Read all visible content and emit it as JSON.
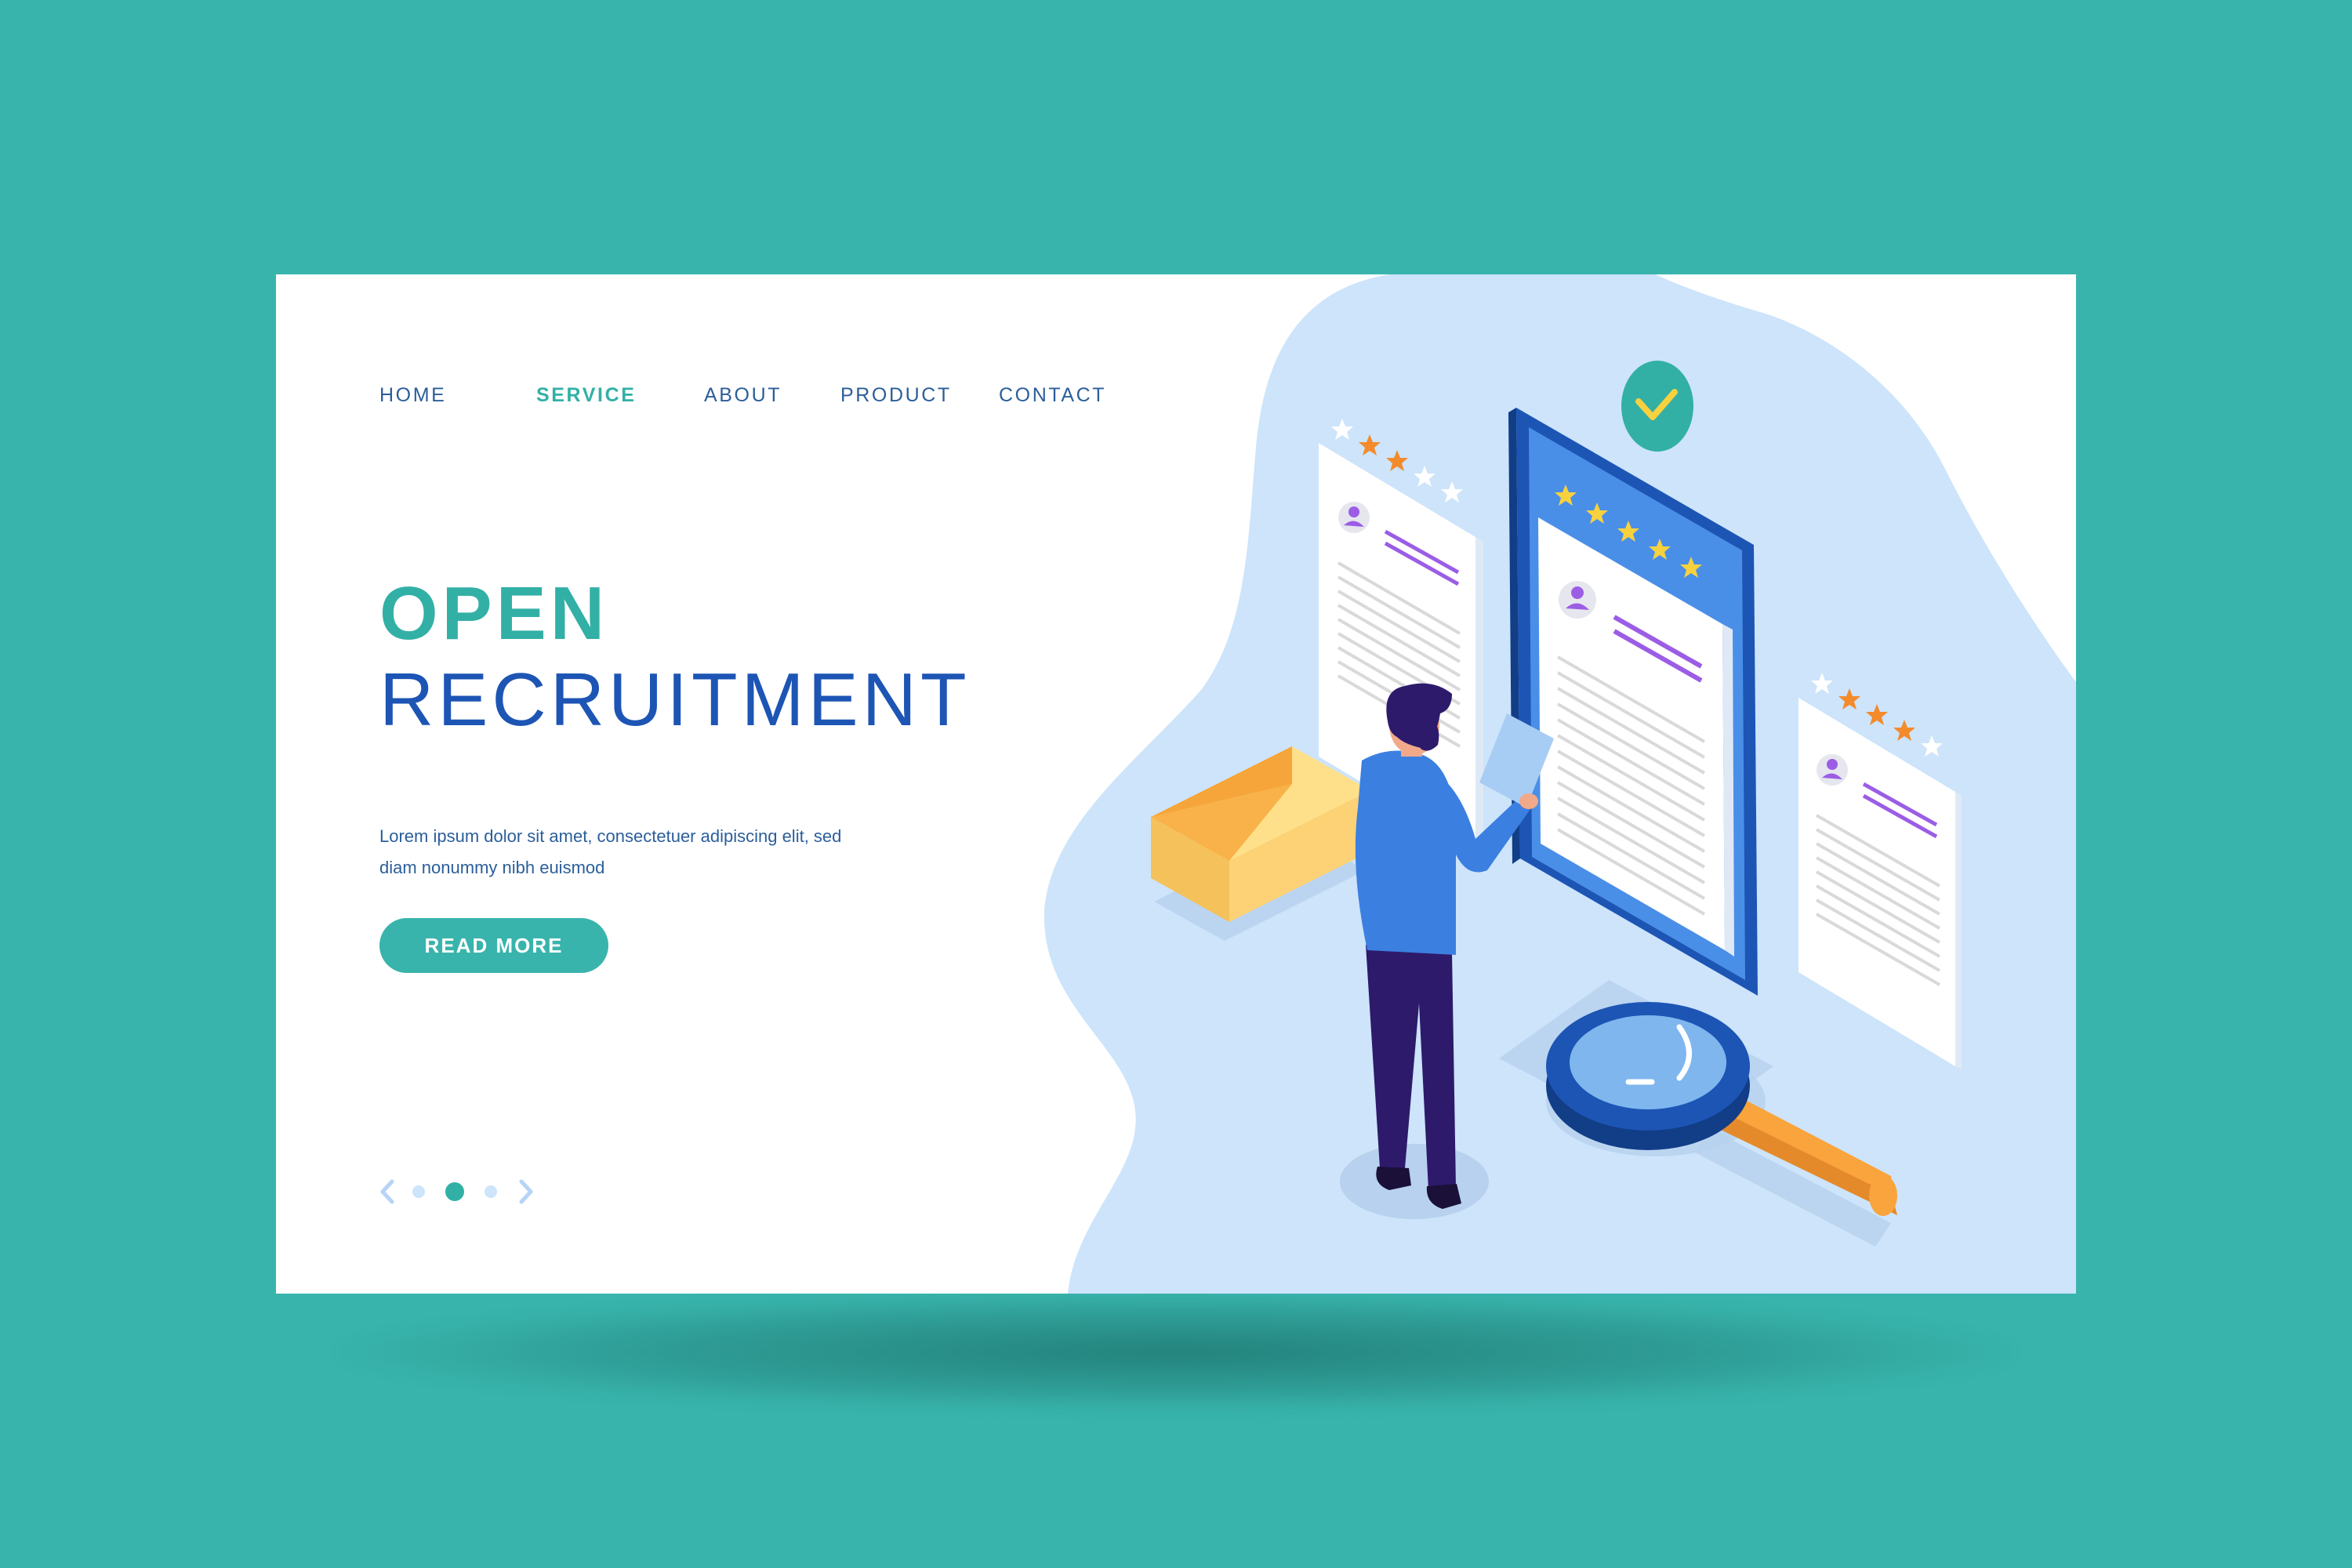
{
  "nav": {
    "items": [
      {
        "label": "HOME"
      },
      {
        "label": "SERVICE",
        "active": true
      },
      {
        "label": "ABOUT"
      },
      {
        "label": "PRODUCT"
      },
      {
        "label": "CONTACT"
      }
    ]
  },
  "hero": {
    "title_line1": "OPEN",
    "title_line2": "RECRUITMENT",
    "description": "Lorem ipsum dolor sit amet, consectetuer adipiscing elit, sed diam nonummy nibh euismod",
    "cta_label": "READ MORE"
  },
  "pager": {
    "count": 3,
    "active_index": 1,
    "prev_icon": "chevron-left-icon",
    "next_icon": "chevron-right-icon"
  },
  "icons": [
    "check-badge-icon",
    "star-icon",
    "user-icon",
    "envelope-icon",
    "magnifying-glass-icon",
    "tablet-icon",
    "resume-document-icon"
  ],
  "colors": {
    "background": "#38b4ac",
    "card": "#ffffff",
    "accent_teal": "#32b0a6",
    "accent_blue": "#1d55b5",
    "nav_text": "#2b5e9a",
    "blob": "#cde4fb",
    "star_orange": "#f38b2d",
    "star_yellow": "#f7d23e"
  }
}
